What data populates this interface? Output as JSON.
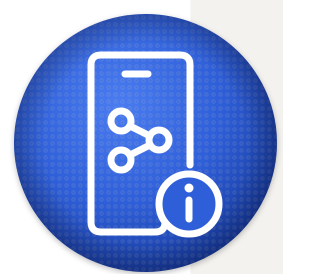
{
  "icon": {
    "name": "phone-share-info-icon",
    "parts": [
      "smartphone-icon",
      "share-icon",
      "info-icon"
    ]
  },
  "colors": {
    "ball": "#2f5fd8",
    "ball_dark": "#1c3fae",
    "ball_light": "#4a7cf0",
    "icon_stroke": "#ffffff",
    "page_background": "#ffffff",
    "side_panel": "#f4f2ee"
  }
}
